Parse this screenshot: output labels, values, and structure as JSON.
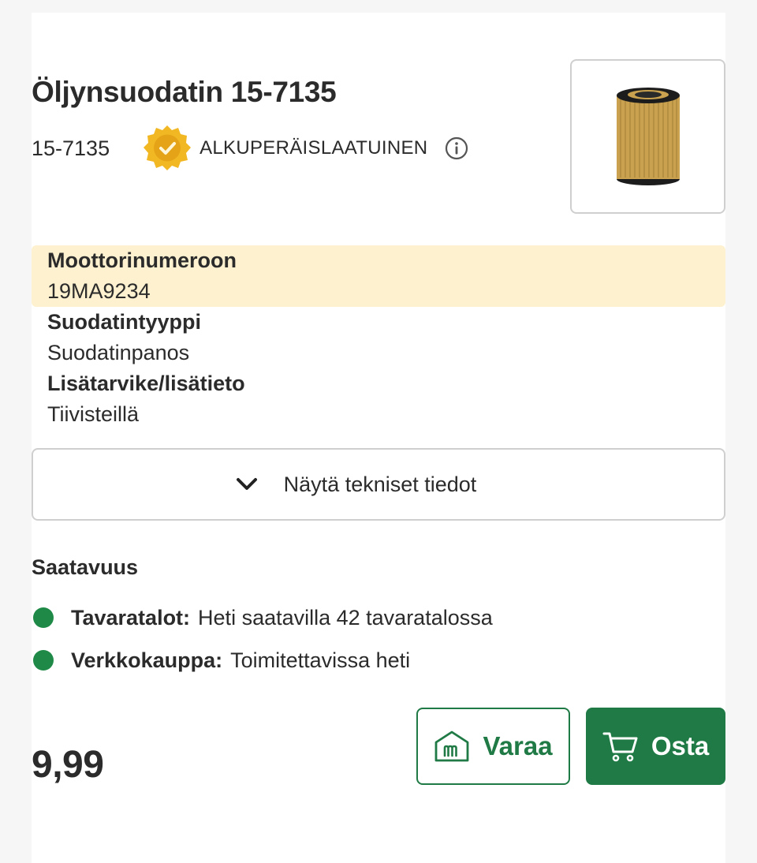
{
  "product": {
    "title": "Öljynsuodatin 15-7135",
    "sku": "15-7135",
    "quality_badge": "ALKUPERÄISLAATUINEN",
    "price": "9,99"
  },
  "specs": [
    {
      "label": "Moottorinumeroon",
      "value": "19MA9234",
      "highlighted": true
    },
    {
      "label": "Suodatintyyppi",
      "value": "Suodatinpanos",
      "highlighted": false
    },
    {
      "label": "Lisätarvike/lisätieto",
      "value": "Tiivisteillä",
      "highlighted": false
    }
  ],
  "toggle": {
    "label": "Näytä tekniset tiedot"
  },
  "availability": {
    "title": "Saatavuus",
    "items": [
      {
        "key": "Tavaratalot:",
        "value": "Heti saatavilla 42 tavaratalossa"
      },
      {
        "key": "Verkkokauppa:",
        "value": "Toimitettavissa heti"
      }
    ]
  },
  "buttons": {
    "reserve": "Varaa",
    "buy": "Osta"
  },
  "colors": {
    "accent": "#1f7a45",
    "highlight": "#fdf1cf",
    "status_ok": "#1f8a47",
    "badge_gold": "#f2b824"
  },
  "icons": [
    "quality-badge-icon",
    "info-icon",
    "chevron-down-icon",
    "store-icon",
    "cart-icon"
  ]
}
